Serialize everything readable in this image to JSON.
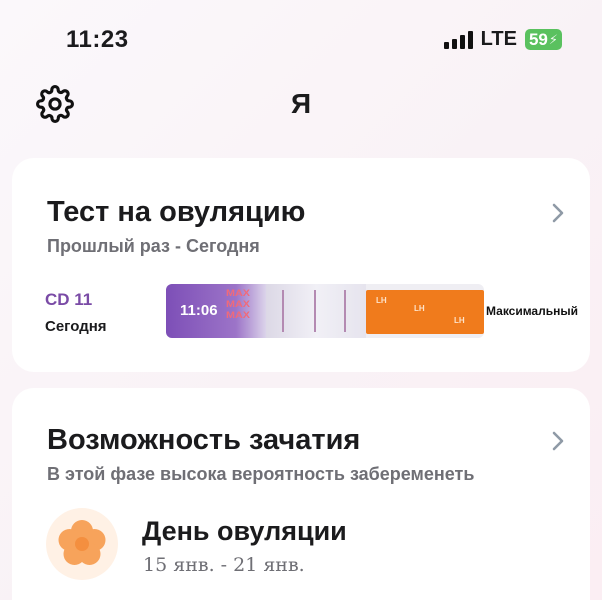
{
  "status_bar": {
    "time": "11:23",
    "network": "LTE",
    "battery": "59"
  },
  "header": {
    "title": "Я"
  },
  "ovulation_test": {
    "title": "Тест на овуляцию",
    "subtitle": "Прошлый раз - Сегодня",
    "cycle_day": "CD 11",
    "day_label": "Сегодня",
    "strip_time": "11:06",
    "strip_marks": [
      "MAX",
      "MAX",
      "MAX"
    ],
    "strip_print": "LH",
    "result": "Максимальный",
    "accent_color": "#7d4fb7"
  },
  "conception": {
    "title": "Возможность зачатия",
    "subtitle": "В этой фазе высока вероятность забеременеть",
    "phase": "День овуляции",
    "dates": "15 янв. - 21 янв.",
    "icon": "flower-icon",
    "icon_color": "#f7a35b"
  }
}
